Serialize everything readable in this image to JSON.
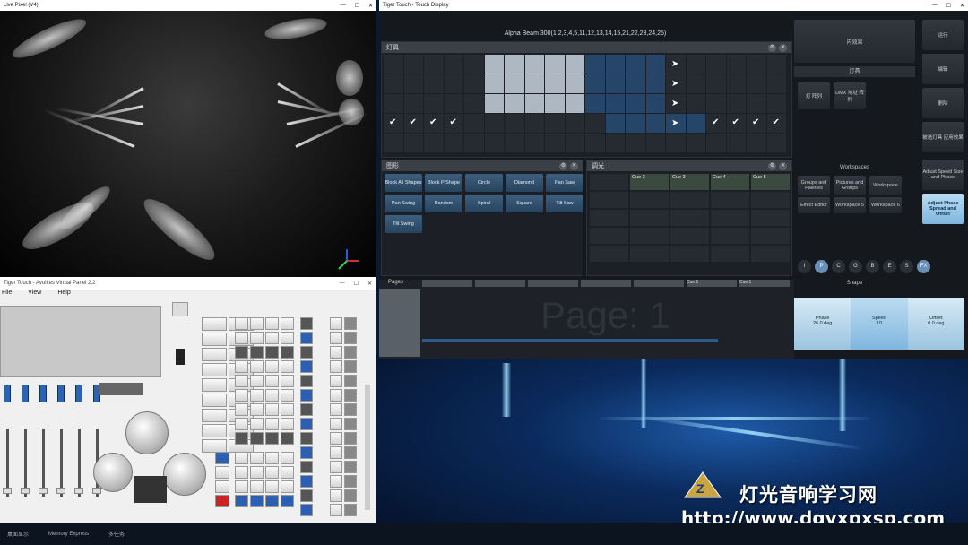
{
  "live_window": {
    "title": "Live Pixel (V4)"
  },
  "touch_window": {
    "title": "Tiger Touch - Touch Display",
    "selection": "Alpha Beam 300(1,2,3,4,5,11,12,13,14,15,21,22,23,24,25)",
    "fixtures_panel": {
      "title": "灯具"
    },
    "shape_panel": {
      "title": "图形",
      "buttons": [
        "Block All Shapes",
        "Block P Shape",
        "Circle",
        "Diamond",
        "Pan Saw",
        "Pan Swing",
        "Random",
        "Spiral",
        "Square",
        "Tilt Saw",
        "Tilt Swing"
      ]
    },
    "cue_panel": {
      "title": "调光",
      "cues": [
        "Cue 2",
        "Cue 3",
        "Cue 4",
        "Cue 5"
      ]
    },
    "page_area": {
      "label": "Pages",
      "page_text": "Page: 1",
      "cue_tabs": [
        "Cue 1",
        "Cue 1"
      ]
    },
    "right": {
      "header": "内效果",
      "section_label": "灯具",
      "fx_buttons": [
        "灯 阵列",
        "DMX 地址 阵列"
      ],
      "workspaces_label": "Workspaces",
      "ws_buttons": [
        "Groups and Palettes",
        "Pictures and Groups",
        "Workspace",
        "Effect Editor",
        "Workspace 5",
        "Workspace 6"
      ],
      "shape_label": "Shape",
      "circles": [
        "I",
        "P",
        "C",
        "G",
        "B",
        "E",
        "S",
        "FX"
      ],
      "param_labels": [
        "Phase",
        "Speed",
        "Offset"
      ],
      "param_values": [
        "26.0 deg",
        "10",
        "0.0 deg"
      ]
    },
    "side_buttons": [
      "运行",
      "编辑",
      "删除",
      "被选灯具 应用效果",
      "Adjust Speed Size and Phase",
      "Adjust Phase Spread and Offset"
    ]
  },
  "vpanel": {
    "title": "Tiger Touch - Avolites Virtual Panel 2.2",
    "menu": [
      "File",
      "View",
      "Help"
    ]
  },
  "watermark": {
    "cn": "灯光音响学习网",
    "url": "http://www.dgyxpxsp.com"
  },
  "taskbar": {
    "items": [
      "桌面显示",
      "Memory Express",
      "多任务"
    ]
  }
}
